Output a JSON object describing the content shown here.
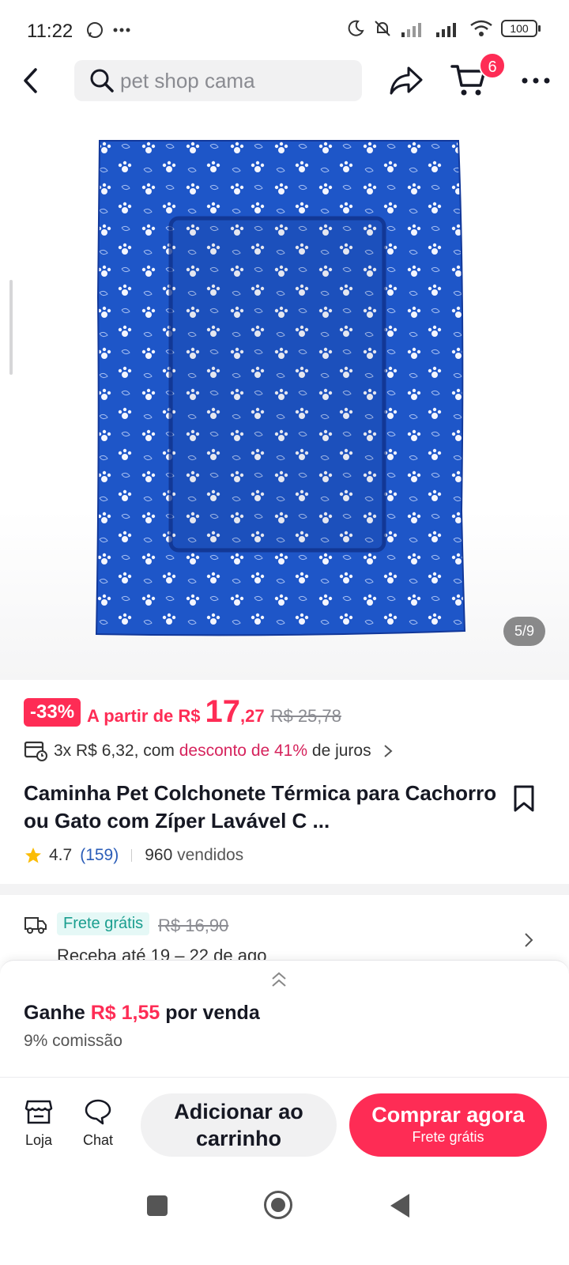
{
  "status_bar": {
    "time": "11:22",
    "battery": "100"
  },
  "header": {
    "search_placeholder": "pet shop cama",
    "cart_count": "6"
  },
  "gallery": {
    "page_indicator": "5/9"
  },
  "price": {
    "discount": "-33%",
    "prefix": "A partir de R$",
    "integer": "17",
    "decimal": ",27",
    "original": "R$ 25,78"
  },
  "installment": {
    "text_before": "3x R$ 6,32, com",
    "highlight": "desconto de 41%",
    "text_after": "de juros"
  },
  "product": {
    "title": "Caminha Pet Colchonete Térmica para Cachorro ou Gato com Zíper Lavável C ...",
    "rating": "4.7",
    "review_count": "(159)",
    "sold": "960",
    "sold_label": "vendidos"
  },
  "shipping": {
    "free_label": "Frete grátis",
    "old_price": "R$ 16,90",
    "delivery": "Receba até 19 – 22 de ago"
  },
  "commission": {
    "prefix": "Ganhe",
    "amount": "R$ 1,55",
    "suffix": "por venda",
    "subtitle": "9% comissão"
  },
  "actions": {
    "shop_label": "Loja",
    "chat_label": "Chat",
    "add_to_cart_line1": "Adicionar ao",
    "add_to_cart_line2": "carrinho",
    "buy_now": "Comprar agora",
    "buy_now_sub": "Frete grátis"
  },
  "colors": {
    "accent": "#fe2c55",
    "product_blue": "#1e56c8"
  }
}
